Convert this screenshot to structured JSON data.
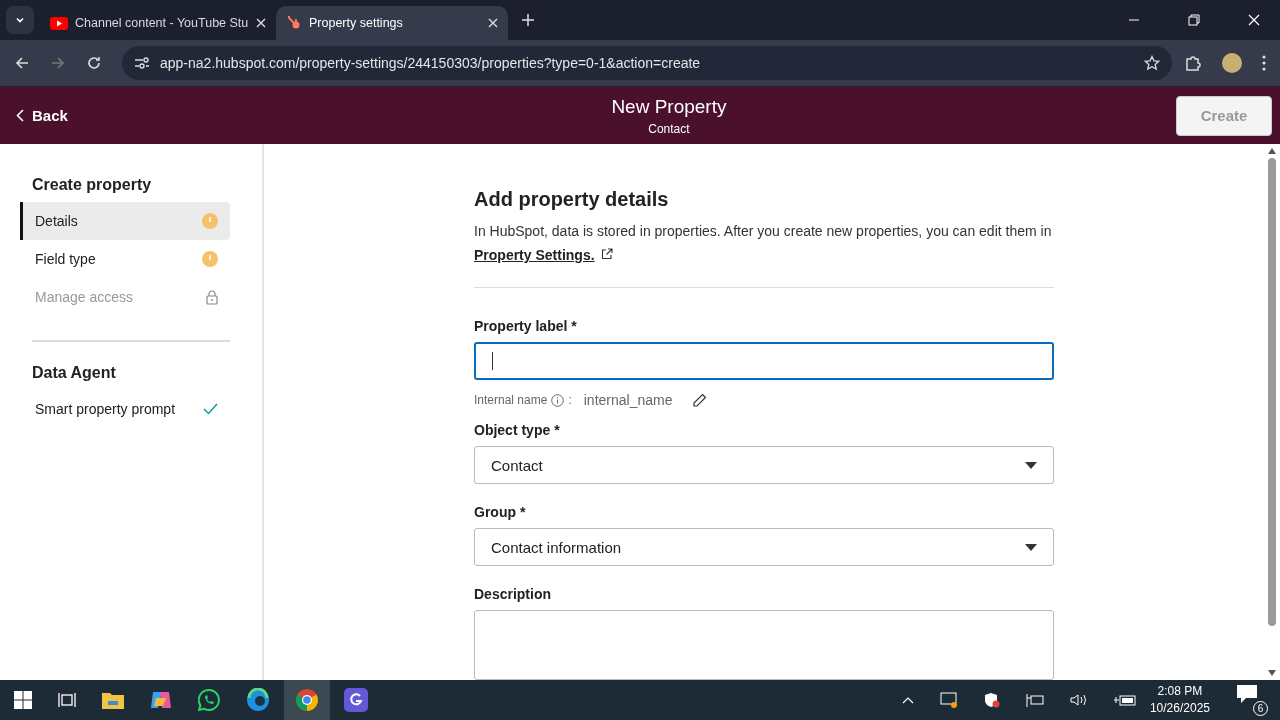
{
  "browser": {
    "tabs": [
      {
        "title": "Channel content - YouTube Stu",
        "kind": "video",
        "selected": false
      },
      {
        "title": "Property settings",
        "kind": "sprocket",
        "selected": true
      }
    ],
    "url": "app-na2.hubspot.com/property-settings/244150303/properties?type=0-1&action=create"
  },
  "header": {
    "back": "Back",
    "title": "New Property",
    "subtitle": "Contact",
    "create_button": {
      "label": "Create",
      "disabled": true
    }
  },
  "sidebar": {
    "sections": [
      {
        "title": "Create property",
        "items": [
          {
            "label": "Details",
            "selected": true,
            "disabled": false,
            "kind": "warning"
          },
          {
            "label": "Field type",
            "selected": false,
            "disabled": false,
            "kind": "warning"
          },
          {
            "label": "Manage access",
            "selected": false,
            "disabled": true,
            "kind": "locked"
          }
        ]
      },
      {
        "title": "Data Agent",
        "items": [
          {
            "label": "Smart property prompt",
            "selected": false,
            "disabled": false,
            "kind": "done"
          }
        ]
      }
    ]
  },
  "form": {
    "heading": "Add property details",
    "intro": "In HubSpot, data is stored in properties. After you create new properties, you can edit them in",
    "intro_link": "Property Settings.",
    "fields": [
      {
        "kind": "text",
        "label": "Property label *",
        "focused": true,
        "internal_name_label": "Internal name",
        "internal_name_suffix": ":",
        "internal_name": "internal_name"
      },
      {
        "kind": "select",
        "label": "Object type *",
        "value": "Contact"
      },
      {
        "kind": "select",
        "label": "Group *",
        "value": "Contact information"
      },
      {
        "kind": "textarea",
        "label": "Description"
      }
    ]
  },
  "taskbar": {
    "time": "2:08 PM",
    "date": "10/26/2025",
    "notifications": "6"
  }
}
